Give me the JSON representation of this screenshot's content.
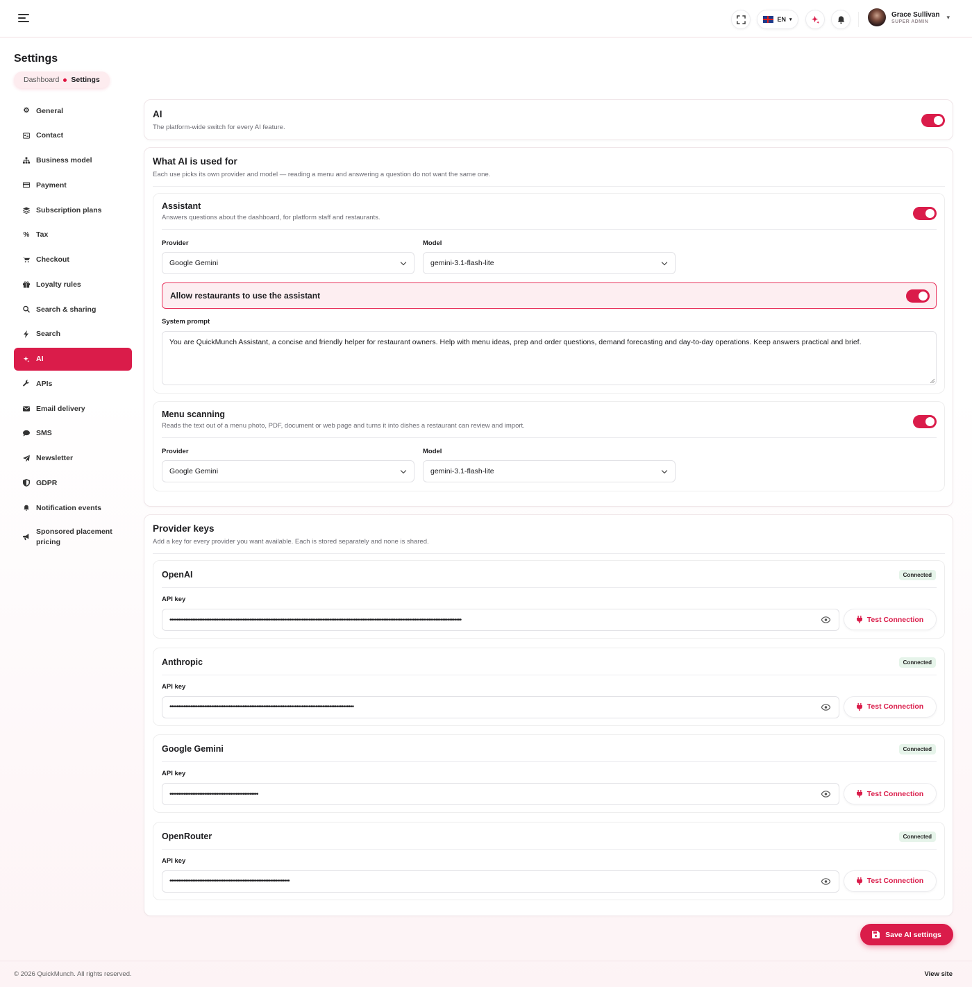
{
  "header": {
    "lang": "EN",
    "user_name": "Grace Sullivan",
    "user_role": "SUPER ADMIN"
  },
  "page": {
    "title": "Settings",
    "breadcrumb": [
      "Dashboard",
      "Settings"
    ]
  },
  "sidebar": {
    "items": [
      {
        "label": "General",
        "icon": "gear-icon"
      },
      {
        "label": "Contact",
        "icon": "id-card-icon"
      },
      {
        "label": "Business model",
        "icon": "sitemap-icon"
      },
      {
        "label": "Payment",
        "icon": "credit-card-icon"
      },
      {
        "label": "Subscription plans",
        "icon": "layers-icon"
      },
      {
        "label": "Tax",
        "icon": "percent-icon"
      },
      {
        "label": "Checkout",
        "icon": "cart-icon"
      },
      {
        "label": "Loyalty rules",
        "icon": "gift-icon"
      },
      {
        "label": "Search & sharing",
        "icon": "search-icon"
      },
      {
        "label": "Search",
        "icon": "bolt-icon"
      },
      {
        "label": "AI",
        "icon": "sparkles-icon"
      },
      {
        "label": "APIs",
        "icon": "wrench-icon"
      },
      {
        "label": "Email delivery",
        "icon": "envelope-icon"
      },
      {
        "label": "SMS",
        "icon": "chat-icon"
      },
      {
        "label": "Newsletter",
        "icon": "paper-plane-icon"
      },
      {
        "label": "GDPR",
        "icon": "shield-icon"
      },
      {
        "label": "Notification events",
        "icon": "bell-icon"
      },
      {
        "label": "Sponsored placement pricing",
        "icon": "megaphone-icon"
      }
    ],
    "active": "AI"
  },
  "ai_card": {
    "title": "AI",
    "desc": "The platform-wide switch for every AI feature.",
    "enabled": true
  },
  "usage": {
    "title": "What AI is used for",
    "desc": "Each use picks its own provider and model — reading a menu and answering a question do not want the same one.",
    "assistant": {
      "title": "Assistant",
      "desc": "Answers questions about the dashboard, for platform staff and restaurants.",
      "enabled": true,
      "provider_label": "Provider",
      "provider": "Google Gemini",
      "model_label": "Model",
      "model": "gemini-3.1-flash-lite",
      "allow_label": "Allow restaurants to use the assistant",
      "allow_enabled": true,
      "prompt_label": "System prompt",
      "prompt": "You are QuickMunch Assistant, a concise and friendly helper for restaurant owners. Help with menu ideas, prep and order questions, demand forecasting and day-to-day operations. Keep answers practical and brief."
    },
    "menu": {
      "title": "Menu scanning",
      "desc": "Reads the text out of a menu photo, PDF, document or web page and turns it into dishes a restaurant can review and import.",
      "enabled": true,
      "provider_label": "Provider",
      "provider": "Google Gemini",
      "model_label": "Model",
      "model": "gemini-3.1-flash-lite"
    }
  },
  "keys": {
    "title": "Provider keys",
    "desc": "Add a key for every provider you want available. Each is stored separately and none is shared.",
    "providers": [
      {
        "name": "OpenAI",
        "status": "Connected",
        "key_label": "API key",
        "key": "••••••••••••••••••••••••••••••••••••••••••••••••••••••••••••••••••••••••••••••••••••••••••••••••••••••••••••••••••••••••••••••••••••••••••••••••••••••••••••••••••••••••",
        "test": "Test Connection"
      },
      {
        "name": "Anthropic",
        "status": "Connected",
        "key_label": "API key",
        "key": "••••••••••••••••••••••••••••••••••••••••••••••••••••••••••••••••••••••••••••••••••••••••••••••••••••••••••",
        "test": "Test Connection"
      },
      {
        "name": "Google Gemini",
        "status": "Connected",
        "key_label": "API key",
        "key": "•••••••••••••••••••••••••••••••••••••••••••••••••••",
        "test": "Test Connection"
      },
      {
        "name": "OpenRouter",
        "status": "Connected",
        "key_label": "API key",
        "key": "•••••••••••••••••••••••••••••••••••••••••••••••••••••••••••••••••••••",
        "test": "Test Connection"
      }
    ]
  },
  "save_label": "Save AI settings",
  "footer": {
    "copyright": "© 2026 QuickMunch. All rights reserved.",
    "view_site": "View site"
  },
  "colors": {
    "accent": "#da1c4a",
    "badge_bg": "#e6f4ea"
  }
}
